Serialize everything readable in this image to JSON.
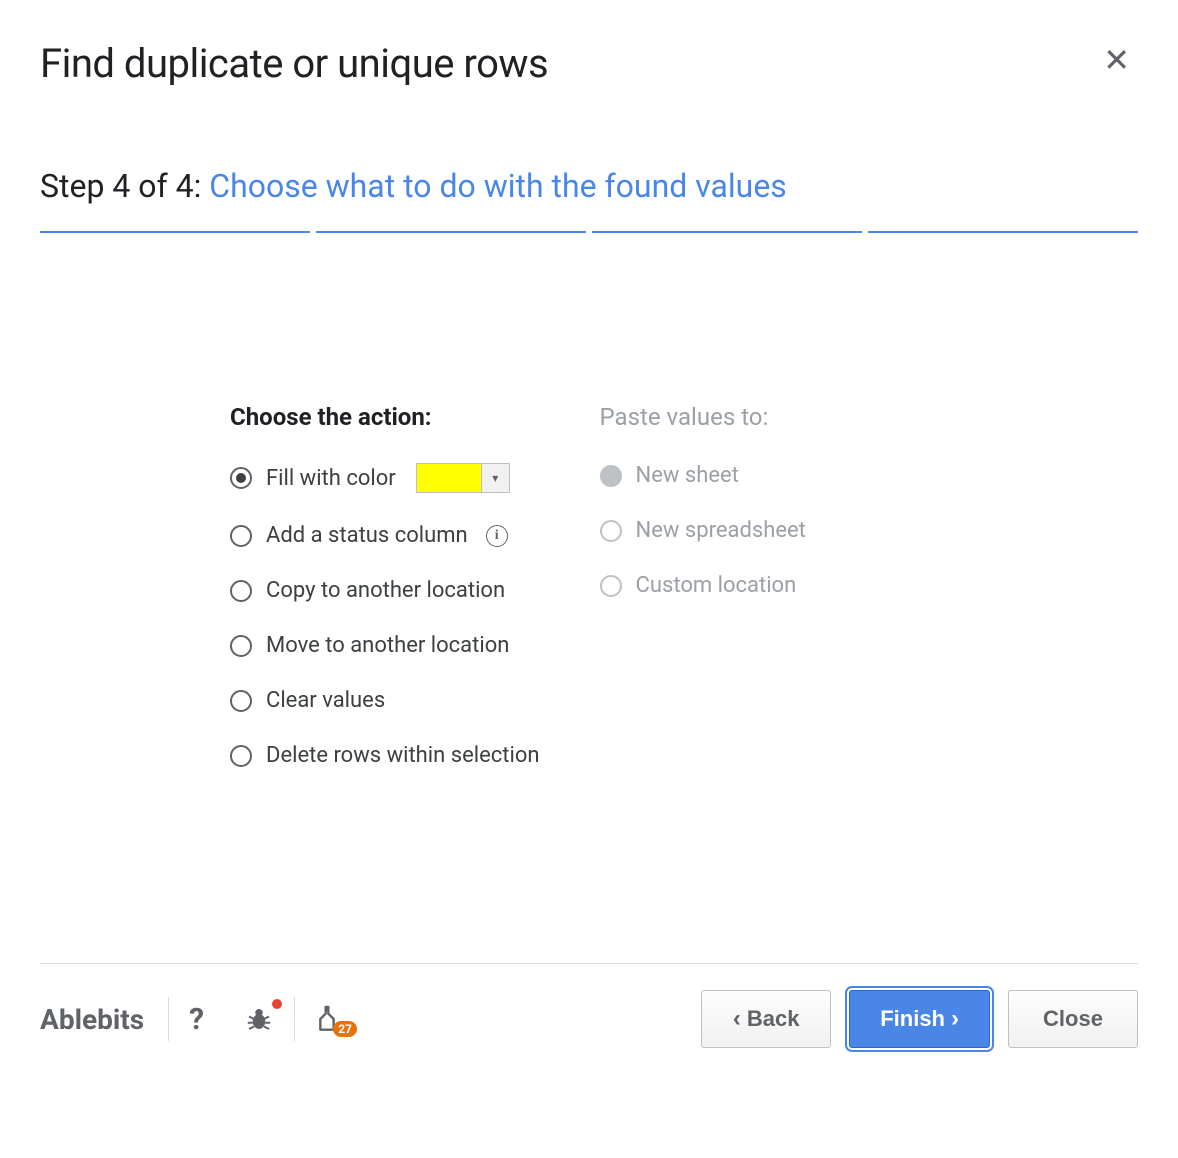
{
  "header": {
    "title": "Find duplicate or unique rows"
  },
  "step": {
    "prefix": "Step 4 of 4: ",
    "instruction": "Choose what to do with the found values"
  },
  "actions": {
    "heading": "Choose the action:",
    "items": [
      {
        "label": "Fill with color",
        "selected": true,
        "hasColor": true
      },
      {
        "label": "Add a status column",
        "selected": false,
        "hasInfo": true
      },
      {
        "label": "Copy to another location",
        "selected": false
      },
      {
        "label": "Move to another location",
        "selected": false
      },
      {
        "label": "Clear values",
        "selected": false
      },
      {
        "label": "Delete rows within selection",
        "selected": false
      }
    ],
    "colorValue": "#ffff00"
  },
  "paste": {
    "heading": "Paste values to:",
    "items": [
      {
        "label": "New sheet",
        "filled": true
      },
      {
        "label": "New spreadsheet",
        "filled": false
      },
      {
        "label": "Custom location",
        "filled": false
      }
    ]
  },
  "footer": {
    "brand": "Ablebits",
    "badgeCount": "27",
    "buttons": {
      "back": "Back",
      "finish": "Finish",
      "close": "Close"
    }
  }
}
